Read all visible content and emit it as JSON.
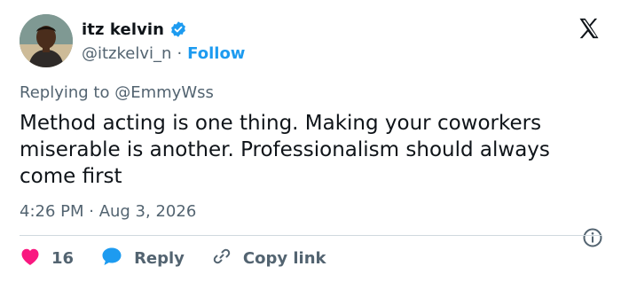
{
  "author": {
    "display_name": "itz kelvin",
    "handle": "@itzkelvi_n",
    "separator": "·",
    "follow_label": "Follow"
  },
  "replying": {
    "prefix": "Replying to",
    "mention": "@EmmyWss"
  },
  "tweet": {
    "text": "Method acting is one thing. Making your coworkers miserable is another. Professionalism should always come first",
    "timestamp": "4:26 PM · Aug 3, 2026"
  },
  "actions": {
    "like_count": "16",
    "reply_label": "Reply",
    "copy_label": "Copy link"
  },
  "icons": {
    "verified": "verified-badge-icon",
    "logo": "x-logo-icon",
    "info": "info-icon",
    "like": "heart-icon",
    "reply": "speech-bubble-icon",
    "copy": "link-icon"
  },
  "colors": {
    "accent": "#1d9bf0",
    "like": "#f91880",
    "text": "#0f1419",
    "muted": "#536471"
  }
}
